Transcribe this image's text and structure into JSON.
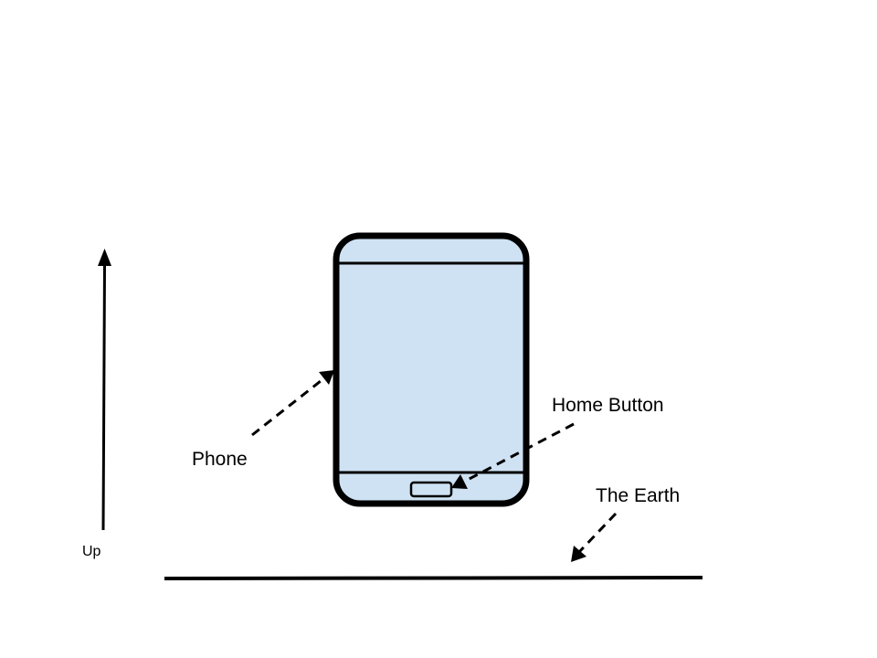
{
  "labels": {
    "up": "Up",
    "phone": "Phone",
    "home_button": "Home Button",
    "earth": "The Earth"
  },
  "colors": {
    "stroke": "#000000",
    "phone_fill": "#cfe2f3",
    "background": "#ffffff"
  }
}
